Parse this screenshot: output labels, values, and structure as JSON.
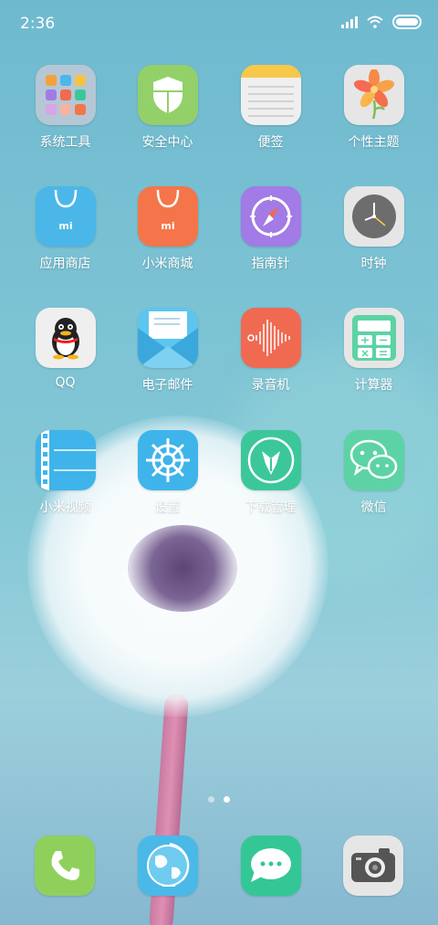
{
  "status_bar": {
    "time": "2:36"
  },
  "apps": [
    {
      "id": "system-tools",
      "label": "系统工具",
      "icon": "folder-icon",
      "color": "#b4c6d3"
    },
    {
      "id": "security-center",
      "label": "安全中心",
      "icon": "shield-icon",
      "color": "#93d06a"
    },
    {
      "id": "notes",
      "label": "便签",
      "icon": "notepad-icon",
      "color": "#efefef"
    },
    {
      "id": "themes",
      "label": "个性主题",
      "icon": "flower-icon",
      "color": "#e6e6e6"
    },
    {
      "id": "app-store",
      "label": "应用商店",
      "icon": "shopping-bag-icon",
      "color": "#4bb7e8"
    },
    {
      "id": "mi-store",
      "label": "小米商城",
      "icon": "shopping-bag-icon",
      "color": "#f5754a"
    },
    {
      "id": "compass",
      "label": "指南针",
      "icon": "compass-icon",
      "color": "#a27be6"
    },
    {
      "id": "clock",
      "label": "时钟",
      "icon": "clock-icon",
      "color": "#e6e6e6"
    },
    {
      "id": "qq",
      "label": "QQ",
      "icon": "penguin-icon",
      "color": "#efefef"
    },
    {
      "id": "email",
      "label": "电子邮件",
      "icon": "envelope-icon",
      "color": "#5dc5ee"
    },
    {
      "id": "recorder",
      "label": "录音机",
      "icon": "soundwave-icon",
      "color": "#f06a52"
    },
    {
      "id": "calculator",
      "label": "计算器",
      "icon": "calculator-icon",
      "color": "#e6e6e6"
    },
    {
      "id": "mi-video",
      "label": "小米视频",
      "icon": "film-icon",
      "color": "#3fb4ea"
    },
    {
      "id": "settings",
      "label": "设置",
      "icon": "helm-icon",
      "color": "#3fb4ea"
    },
    {
      "id": "downloads",
      "label": "下载管理",
      "icon": "download-icon",
      "color": "#3cc79a"
    },
    {
      "id": "wechat",
      "label": "微信",
      "icon": "chat-bubbles-icon",
      "color": "#5dd3a5"
    }
  ],
  "dock": [
    {
      "id": "phone",
      "icon": "phone-icon",
      "color": "#8fd05d"
    },
    {
      "id": "browser",
      "icon": "globe-icon",
      "color": "#4ab9e8"
    },
    {
      "id": "messages",
      "icon": "message-icon",
      "color": "#34c795"
    },
    {
      "id": "camera",
      "icon": "camera-icon",
      "color": "#e6e6e6"
    }
  ],
  "pages": {
    "count": 2,
    "active": 2
  }
}
